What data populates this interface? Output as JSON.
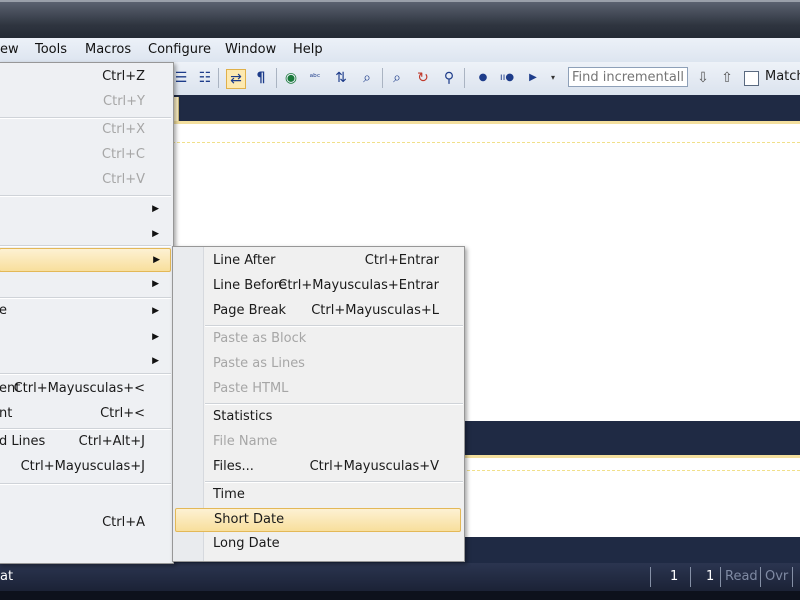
{
  "menubar": {
    "items": [
      "ew",
      "Tools",
      "Macros",
      "Configure",
      "Window",
      "Help"
    ]
  },
  "toolbar": {
    "find_placeholder": "Find incrementally",
    "match_label": "Match"
  },
  "edit_menu": {
    "items": [
      {
        "label": "",
        "shortcut": "Ctrl+Z",
        "disabled": false
      },
      {
        "label": "",
        "shortcut": "Ctrl+Y",
        "disabled": true
      },
      {
        "label": "",
        "shortcut": "Ctrl+X",
        "disabled": true
      },
      {
        "label": "",
        "shortcut": "Ctrl+C",
        "disabled": true
      },
      {
        "label": "",
        "shortcut": "Ctrl+V",
        "disabled": true
      },
      {
        "label": "e",
        "shortcut": ""
      },
      {
        "label": "ent",
        "shortcut": "Ctrl+Mayusculas+<"
      },
      {
        "label": "nt",
        "shortcut": "Ctrl+<"
      },
      {
        "label": "d Lines",
        "shortcut": "Ctrl+Alt+J"
      },
      {
        "label": "",
        "shortcut": "Ctrl+Mayusculas+J"
      },
      {
        "label": "",
        "shortcut": "Ctrl+A"
      }
    ]
  },
  "insert_submenu": {
    "items": [
      {
        "label": "Line After",
        "shortcut": "Ctrl+Entrar",
        "disabled": false
      },
      {
        "label": "Line Before",
        "shortcut": "Ctrl+Mayusculas+Entrar",
        "disabled": false
      },
      {
        "label": "Page Break",
        "shortcut": "Ctrl+Mayusculas+L",
        "disabled": false
      },
      {
        "label": "Paste as Block",
        "shortcut": "",
        "disabled": true
      },
      {
        "label": "Paste as Lines",
        "shortcut": "",
        "disabled": true
      },
      {
        "label": "Paste HTML",
        "shortcut": "",
        "disabled": true
      },
      {
        "label": "Statistics",
        "shortcut": "",
        "disabled": false
      },
      {
        "label": "File Name",
        "shortcut": "",
        "disabled": true
      },
      {
        "label": "Files...",
        "shortcut": "Ctrl+Mayusculas+V",
        "disabled": false
      },
      {
        "label": "Time",
        "shortcut": "",
        "disabled": false
      },
      {
        "label": "Short Date",
        "shortcut": "",
        "disabled": false
      },
      {
        "label": "Long Date",
        "shortcut": "",
        "disabled": false
      }
    ]
  },
  "statusbar": {
    "left_text": "at",
    "line": "1",
    "col": "1",
    "read": "Read",
    "ovr": "Ovr"
  }
}
